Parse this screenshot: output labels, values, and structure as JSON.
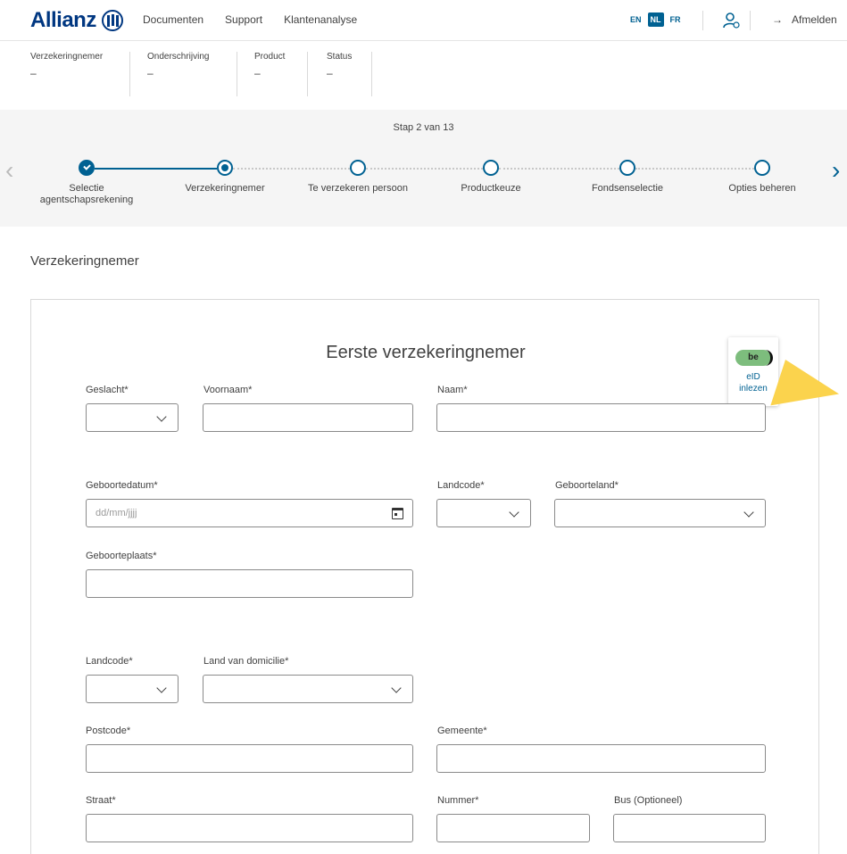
{
  "brand": {
    "name": "Allianz"
  },
  "nav": {
    "items": [
      "Documenten",
      "Support",
      "Klantenanalyse"
    ]
  },
  "languages": {
    "items": [
      "EN",
      "NL",
      "FR"
    ],
    "active": "NL"
  },
  "header": {
    "logout_label": "Afmelden",
    "arrow": "→"
  },
  "info": {
    "columns": [
      {
        "label": "Verzekeringnemer",
        "value": "–"
      },
      {
        "label": "Onderschrijving",
        "value": "–"
      },
      {
        "label": "Product",
        "value": "–"
      },
      {
        "label": "Status",
        "value": "–"
      }
    ]
  },
  "stepper": {
    "title": "Stap 2 van 13",
    "steps": [
      {
        "label": "Selectie agentschapsrekening",
        "state": "done"
      },
      {
        "label": "Verzekeringnemer",
        "state": "current"
      },
      {
        "label": "Te verzekeren persoon",
        "state": "todo"
      },
      {
        "label": "Productkeuze",
        "state": "todo"
      },
      {
        "label": "Fondsenselectie",
        "state": "todo"
      },
      {
        "label": "Opties beheren",
        "state": "todo"
      }
    ]
  },
  "section": {
    "title": "Verzekeringnemer"
  },
  "card": {
    "title": "Eerste verzekeringnemer"
  },
  "eid": {
    "badge": "be",
    "label_line1": "eID",
    "label_line2": "inlezen"
  },
  "form": {
    "geslacht_label": "Geslacht*",
    "voornaam_label": "Voornaam*",
    "naam_label": "Naam*",
    "geboortedatum_label": "Geboortedatum*",
    "geboortedatum_placeholder": "dd/mm/jjjj",
    "landcode_label": "Landcode*",
    "geboorteland_label": "Geboorteland*",
    "geboorteplaats_label": "Geboorteplaats*",
    "landcode2_label": "Landcode*",
    "domicilie_label": "Land van domicilie*",
    "postcode_label": "Postcode*",
    "gemeente_label": "Gemeente*",
    "straat_label": "Straat*",
    "nummer_label": "Nummer*",
    "bus_label": "Bus (Optioneel)"
  },
  "colors": {
    "primary": "#006192",
    "brand": "#003781",
    "accent": "#fbd34d"
  }
}
